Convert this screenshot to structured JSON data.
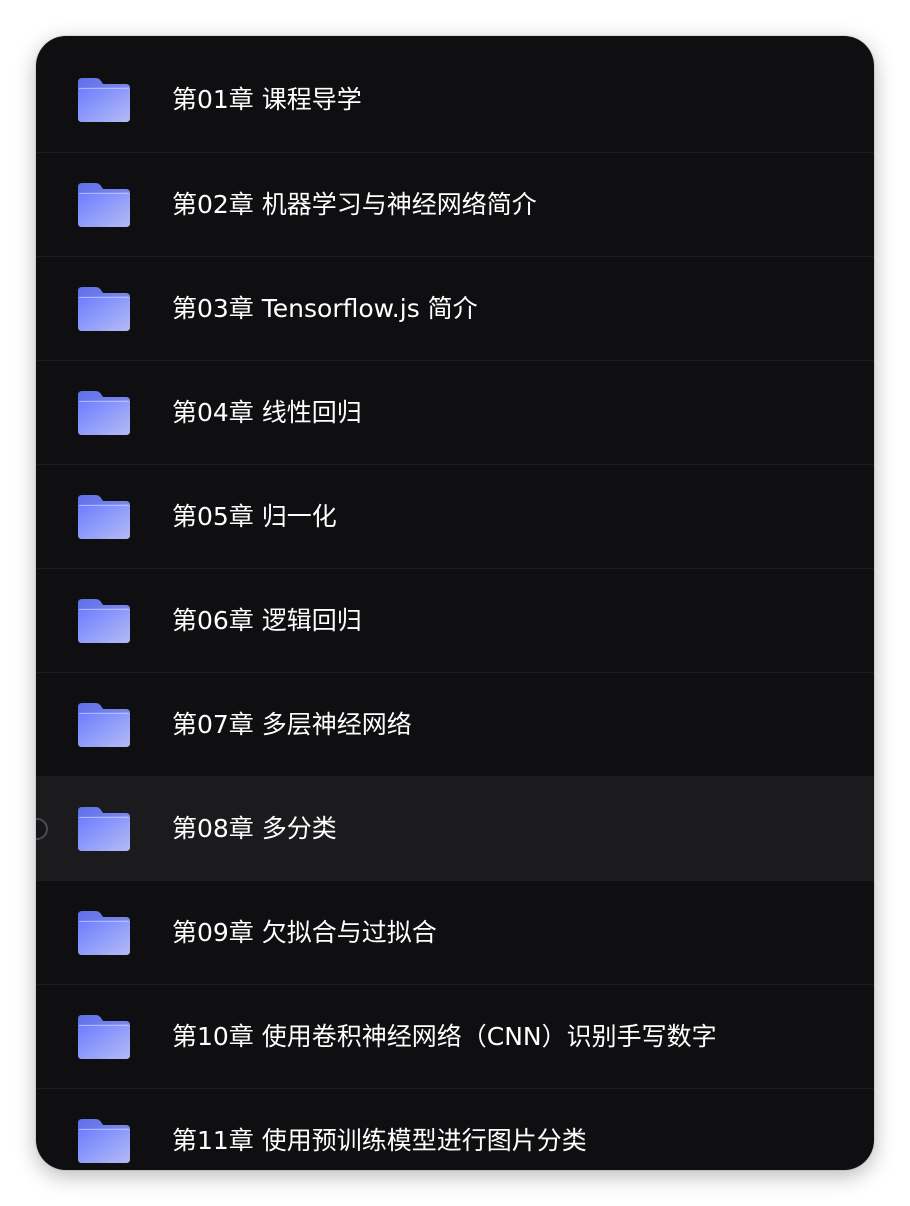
{
  "folders": [
    {
      "label": "第01章 课程导学"
    },
    {
      "label": "第02章 机器学习与神经网络简介"
    },
    {
      "label": "第03章 Tensorflow.js 简介"
    },
    {
      "label": "第04章 线性回归"
    },
    {
      "label": "第05章 归一化"
    },
    {
      "label": "第06章 逻辑回归"
    },
    {
      "label": "第07章 多层神经网络"
    },
    {
      "label": "第08章 多分类",
      "selected": true
    },
    {
      "label": "第09章 欠拟合与过拟合"
    },
    {
      "label": "第10章 使用卷积神经网络（CNN）识别手写数字"
    },
    {
      "label": "第11章 使用预训练模型进行图片分类"
    }
  ],
  "colors": {
    "background": "#0f0f11",
    "selected_row": "#1b1b1e",
    "folder_gradient_start": "#6f80ff",
    "folder_gradient_end": "#b2b9f6"
  },
  "icons": {
    "folder": "folder-icon",
    "selection": "radio-indicator-icon"
  }
}
